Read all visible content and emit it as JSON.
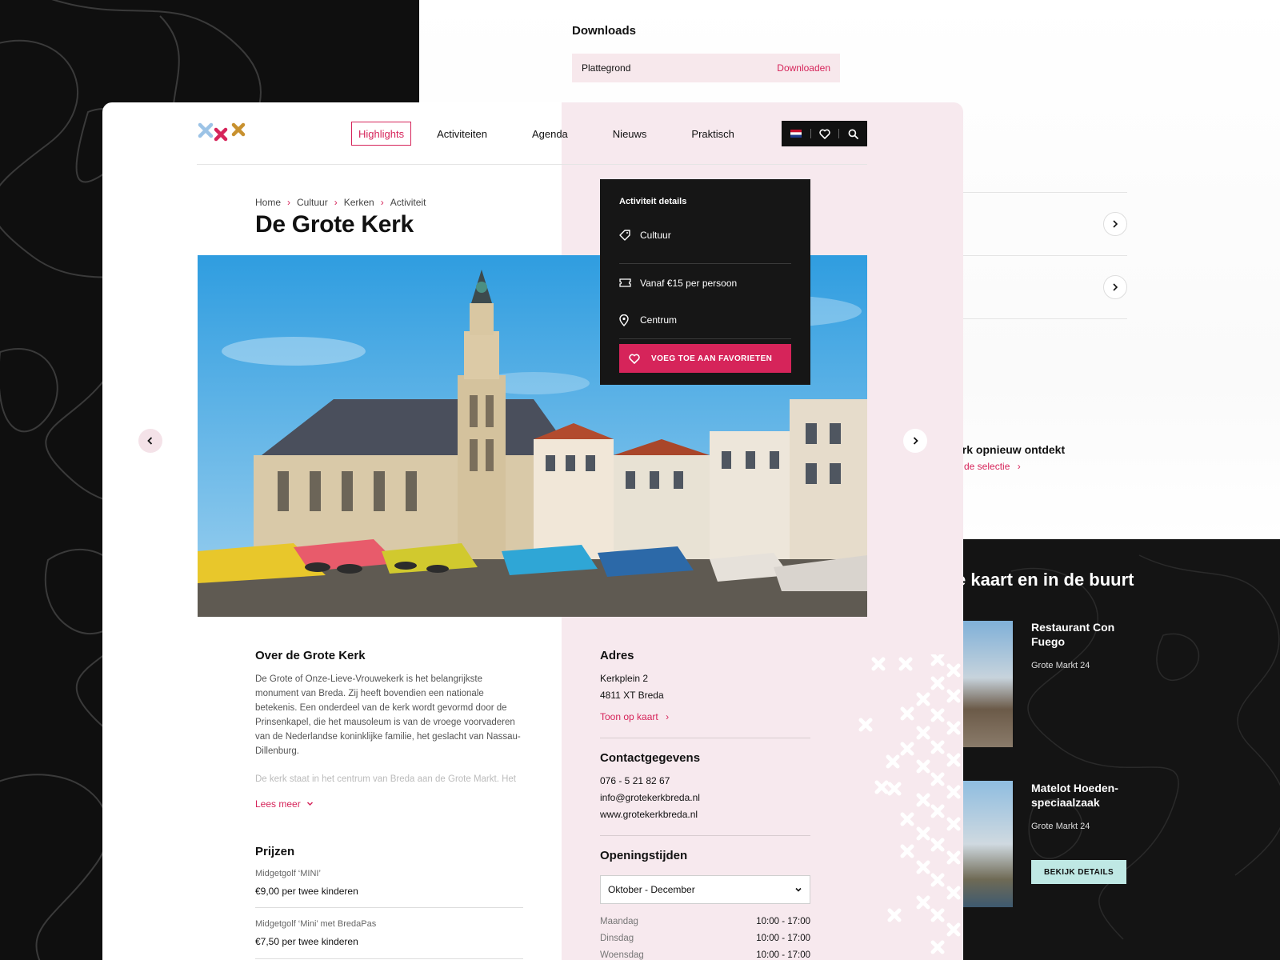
{
  "downloads": {
    "title": "Downloads",
    "item_label": "Plattegrond",
    "item_action": "Downloaden"
  },
  "background": {
    "heading_partial": "erk opnieuw ontdekt",
    "selection_link_partial": "de selectie",
    "nearby_title_partial": "e kaart en in de buurt",
    "nearby": [
      {
        "name": "Restaurant Con Fuego",
        "address": "Grote Markt 24"
      },
      {
        "name": "Matelot Hoeden-speciaalzaak",
        "address": "Grote Markt 24"
      }
    ],
    "details_button": "BEKIJK DETAILS"
  },
  "nav": {
    "items": [
      "Highlights",
      "Activiteiten",
      "Agenda",
      "Nieuws",
      "Praktisch"
    ],
    "active_index": 0
  },
  "breadcrumb": [
    "Home",
    "Cultuur",
    "Kerken",
    "Activiteit"
  ],
  "page": {
    "title": "De Grote Kerk"
  },
  "details": {
    "title": "Activiteit details",
    "category": "Cultuur",
    "price": "Vanaf €15 per persoon",
    "location": "Centrum",
    "favorite_button": "VOEG TOE AAN FAVORIETEN"
  },
  "about": {
    "title": "Over de Grote Kerk",
    "paragraph1": "De Grote of Onze-Lieve-Vrouwekerk is het belangrijkste monument van Breda. Zij heeft bovendien een nationale betekenis. Een onderdeel van de kerk wordt gevormd door de Prinsenkapel, die het mausoleum is van de vroege voorvaderen van de Nederlandse koninklijke familie, het geslacht van Nassau-Dillenburg.",
    "paragraph2": "De kerk staat in het centrum van Breda aan de Grote Markt. Het",
    "read_more": "Lees meer"
  },
  "prices": {
    "title": "Prijzen",
    "items": [
      {
        "label": "Midgetgolf ‘MINI’",
        "value": "€9,00 per twee kinderen"
      },
      {
        "label": "Midgetgolf ‘Mini’ met BredaPas",
        "value": "€7,50 per twee kinderen"
      }
    ]
  },
  "address": {
    "title": "Adres",
    "line1": "Kerkplein 2",
    "line2": "4811 XT Breda",
    "map_link": "Toon op kaart"
  },
  "contact": {
    "title": "Contactgegevens",
    "phone": "076 - 5 21 82 67",
    "email": "info@grotekerkbreda.nl",
    "website": "www.grotekerkbreda.nl"
  },
  "hours": {
    "title": "Openingstijden",
    "period": "Oktober - December",
    "rows": [
      {
        "day": "Maandag",
        "time": "10:00 - 17:00"
      },
      {
        "day": "Dinsdag",
        "time": "10:00 - 17:00"
      },
      {
        "day": "Woensdag",
        "time": "10:00 - 17:00"
      }
    ]
  },
  "colors": {
    "accent": "#d6245a",
    "pink_panel": "#f7e9ee",
    "dark": "#161616",
    "mint": "#bfe8e4"
  }
}
